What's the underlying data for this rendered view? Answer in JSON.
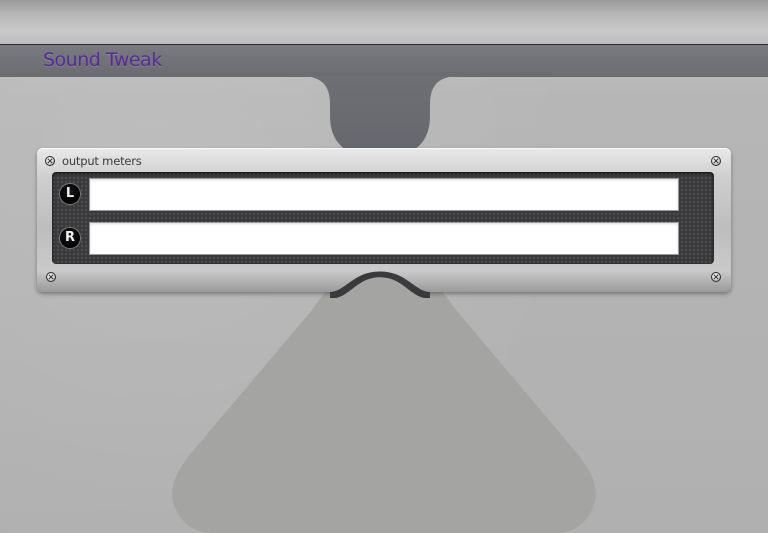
{
  "app": {
    "title": "Sound Tweak"
  },
  "output_meters": {
    "title": "output meters",
    "channels": [
      {
        "label": "L",
        "level": 0
      },
      {
        "label": "R",
        "level": 0
      }
    ]
  },
  "colors": {
    "title_text": "#5a2a9a",
    "title_bar": "#6e6f74",
    "background": "#b5b5b5",
    "meter_well": "#3a3a3c",
    "meter_bar": "#ffffff"
  }
}
